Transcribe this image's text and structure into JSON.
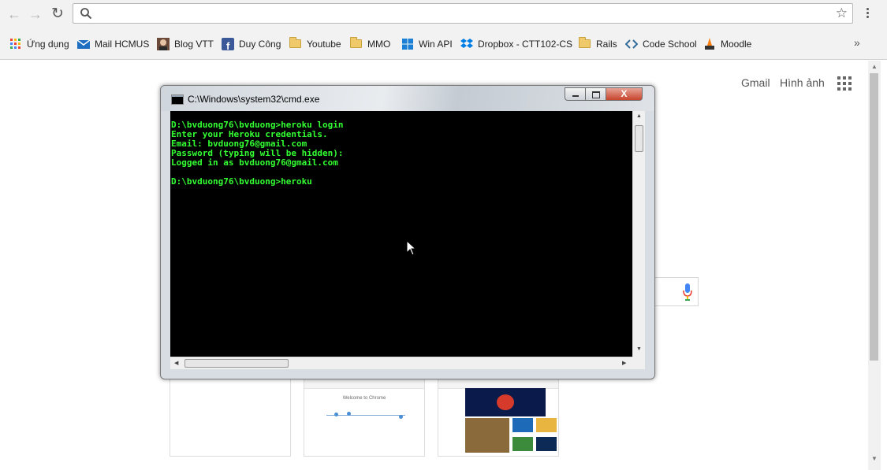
{
  "browser": {
    "address": {
      "value": "",
      "placeholder": ""
    },
    "bookmarks": [
      {
        "label": "Ứng dụng",
        "icon": "apps-grid-icon"
      },
      {
        "label": "Mail HCMUS",
        "icon": "mail-icon"
      },
      {
        "label": "Blog VTT",
        "icon": "blog-avatar-icon"
      },
      {
        "label": "Duy Công",
        "icon": "facebook-icon"
      },
      {
        "label": "Youtube",
        "icon": "folder-icon"
      },
      {
        "label": "MMO",
        "icon": "folder-icon"
      },
      {
        "label": "Win API",
        "icon": "windows-icon"
      },
      {
        "label": "Dropbox - CTT102-CS",
        "icon": "dropbox-icon"
      },
      {
        "label": "Rails",
        "icon": "folder-icon"
      },
      {
        "label": "Code School",
        "icon": "code-icon"
      },
      {
        "label": "Moodle",
        "icon": "moodle-icon"
      }
    ],
    "more_bookmarks": "»"
  },
  "google": {
    "gmail": "Gmail",
    "images": "Hình ảnh",
    "thumbnail_2_title": "Welcome to Chrome"
  },
  "cmd": {
    "title": "C:\\Windows\\system32\\cmd.exe",
    "close_label": "X",
    "output": "D:\\bvduong76\\bvduong>heroku login\nEnter your Heroku credentials.\nEmail: bvduong76@gmail.com\nPassword (typing will be hidden):\nLogged in as bvduong76@gmail.com\n\nD:\\bvduong76\\bvduong>heroku"
  },
  "colors": {
    "console_text": "#33ff33",
    "console_bg": "#000000",
    "close_button": "#c7442d"
  }
}
